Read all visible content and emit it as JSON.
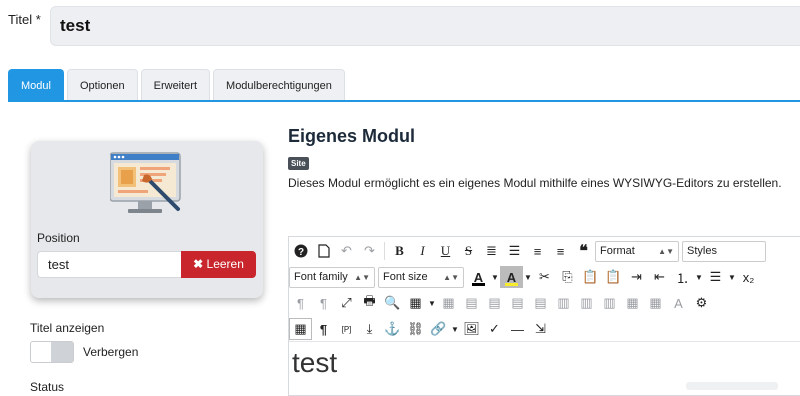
{
  "title_field": {
    "label": "Titel *",
    "value": "test"
  },
  "tabs": [
    {
      "label": "Modul",
      "active": true
    },
    {
      "label": "Optionen",
      "active": false
    },
    {
      "label": "Erweitert",
      "active": false
    },
    {
      "label": "Modulberechtigungen",
      "active": false
    }
  ],
  "module_card": {
    "icon": "monitor-paintbrush-icon",
    "position_label": "Position",
    "position_value": "test",
    "clear_label": "Leeren"
  },
  "show_title": {
    "label": "Titel anzeigen",
    "toggle_text": "Verbergen",
    "enabled": false
  },
  "status_label": "Status",
  "module": {
    "heading": "Eigenes Modul",
    "badge": "Site",
    "description": "Dieses Modul ermöglicht es ein eigenes Modul mithilfe eines WYSIWYG-Editors zu erstellen."
  },
  "editor": {
    "format_select": "Format",
    "styles_select": "Styles",
    "font_family_select": "Font family",
    "font_size_select": "Font size",
    "text_color": "#000000",
    "highlight_color": "#f7ec2b",
    "bold_glyph": "B",
    "italic_glyph": "I",
    "underline_glyph": "U",
    "strike_glyph": "S",
    "content": "test"
  },
  "colors": {
    "accent": "#2196e3",
    "danger": "#c8262c"
  }
}
